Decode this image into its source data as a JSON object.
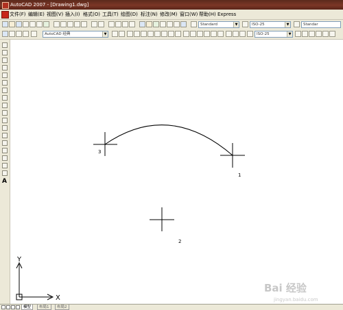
{
  "window": {
    "title": "AutoCAD 2007 - [Drawing1.dwg]"
  },
  "menu": [
    {
      "label": "文件(F)"
    },
    {
      "label": "编辑(E)"
    },
    {
      "label": "视图(V)"
    },
    {
      "label": "插入(I)"
    },
    {
      "label": "格式(O)"
    },
    {
      "label": "工具(T)"
    },
    {
      "label": "绘图(D)"
    },
    {
      "label": "标注(N)"
    },
    {
      "label": "修改(M)"
    },
    {
      "label": "窗口(W)"
    },
    {
      "label": "帮助(H)"
    },
    {
      "label": "Express"
    }
  ],
  "toolbar1": {
    "text_style": "Standard",
    "dim_style": "ISO-25",
    "table_style": "Standar"
  },
  "toolbar2": {
    "workspace": "AutoCAD 经典",
    "dim_style": "ISO-25"
  },
  "drawing": {
    "points": [
      {
        "label": "1"
      },
      {
        "label": "2"
      },
      {
        "label": "3"
      }
    ],
    "ucs": {
      "x_label": "X",
      "y_label": "Y"
    }
  },
  "layout_tabs": [
    {
      "label": "模型"
    },
    {
      "label": "布局1"
    },
    {
      "label": "布局2"
    }
  ],
  "left_toolbar": {
    "text_tool": "A"
  },
  "watermark": {
    "main": "Bai 经验",
    "sub": "jingyan.baidu.com"
  },
  "icons": {
    "draw_tools": [
      "line-icon",
      "construction-line-icon",
      "polyline-icon",
      "polygon-icon",
      "rectangle-icon",
      "arc-icon",
      "circle-icon",
      "revcloud-icon",
      "spline-icon",
      "ellipse-icon",
      "ellipse-arc-icon",
      "insert-block-icon",
      "make-block-icon",
      "point-icon",
      "hatch-icon",
      "gradient-icon",
      "region-icon",
      "table-icon",
      "mtext-icon"
    ]
  }
}
